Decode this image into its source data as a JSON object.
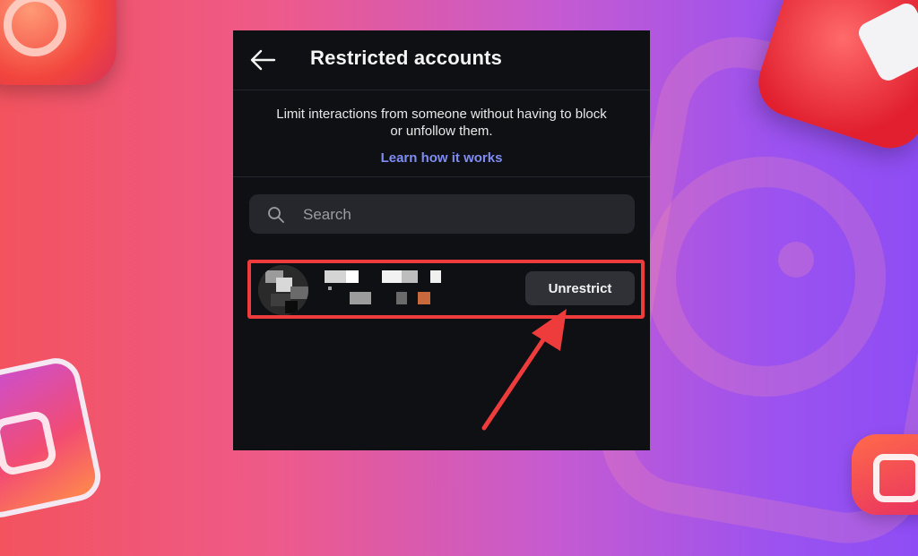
{
  "header": {
    "title": "Restricted accounts",
    "back_icon": "arrow-left-icon"
  },
  "info": {
    "description": "Limit interactions from someone without having to block or unfollow them.",
    "learn_link": "Learn how it works",
    "link_color": "#7f8df3"
  },
  "search": {
    "placeholder": "Search",
    "value": "",
    "icon": "search-icon"
  },
  "accounts": [
    {
      "name": "",
      "unrestrict_label": "Unrestrict"
    }
  ],
  "colors": {
    "panel_bg": "#0e1014",
    "highlight": "#ee3b3b",
    "button_bg": "#2f3137"
  }
}
